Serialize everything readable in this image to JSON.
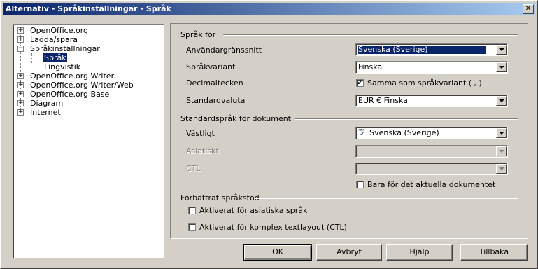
{
  "window": {
    "title": "Alternativ - Språkinställningar - Språk",
    "close_label": "✕"
  },
  "tree": {
    "items": [
      {
        "label": "OpenOffice.org",
        "expander": "+"
      },
      {
        "label": "Ladda/spara",
        "expander": "+"
      },
      {
        "label": "Språkinställningar",
        "expander": "−"
      },
      {
        "label": "Språk"
      },
      {
        "label": "Lingvistik"
      },
      {
        "label": "OpenOffice.org Writer",
        "expander": "+"
      },
      {
        "label": "OpenOffice.org Writer/Web",
        "expander": "+"
      },
      {
        "label": "OpenOffice.org Base",
        "expander": "+"
      },
      {
        "label": "Diagram",
        "expander": "+"
      },
      {
        "label": "Internet",
        "expander": "+"
      }
    ]
  },
  "section1": {
    "title": "Språk för",
    "ui_label": "Användargränssnitt",
    "ui_value": "Svenska (Sverige)",
    "variant_label": "Språkvariant",
    "variant_value": "Finska",
    "decimal_label": "Decimaltecken",
    "decimal_check": "Samma som språkvariant ( , )",
    "currency_label": "Standardvaluta",
    "currency_value": "EUR  €  Finska"
  },
  "section2": {
    "title": "Standardspråk för dokument",
    "western_label": "Västligt",
    "western_value": "Svenska (Sverige)",
    "asian_label": "Asiatiskt",
    "ctl_label": "CTL",
    "current_doc_check": "Bara för det aktuella dokumentet"
  },
  "section3": {
    "title": "Förbättrat språkstöd",
    "asian_check": "Aktiverat för asiatiska språk",
    "ctl_check": "Aktiverat för komplex textlayout (CTL)"
  },
  "buttons": {
    "ok": "OK",
    "cancel": "Avbryt",
    "help": "Hjälp",
    "back": "Tillbaka"
  },
  "colors": {
    "titlebar_start": "#0a246a",
    "titlebar_end": "#a6caf0",
    "selection": "#0a246a",
    "face": "#d4d0c8"
  }
}
